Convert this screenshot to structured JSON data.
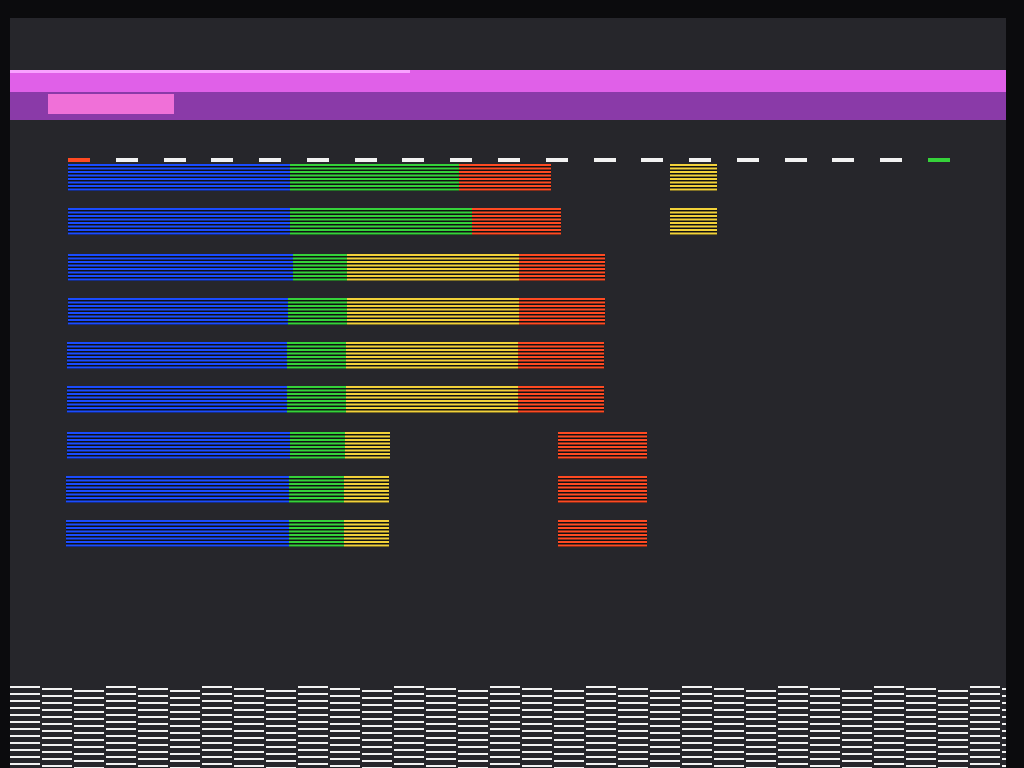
{
  "screen": {
    "description_colors": {
      "background": "#26262b",
      "magenta_light": "#e060e8",
      "magenta_dark": "#8a3aa8",
      "magenta_pink": "#f070d8",
      "blue": "#1a4cff",
      "green": "#35d23a",
      "yellow": "#f2d23a",
      "red": "#ff4a22",
      "white": "#f2f2f2"
    }
  },
  "bar_rows": [
    {
      "segments": [
        {
          "color": "blue",
          "fraction": 0.46
        },
        {
          "color": "green",
          "fraction": 0.35
        },
        {
          "color": "red",
          "fraction": 0.19
        }
      ]
    },
    {
      "segments": [
        {
          "color": "blue",
          "fraction": 0.45
        },
        {
          "color": "green",
          "fraction": 0.37
        },
        {
          "color": "red",
          "fraction": 0.18
        }
      ]
    },
    {
      "segments": [
        {
          "color": "blue",
          "fraction": 0.42
        },
        {
          "color": "green",
          "fraction": 0.1
        },
        {
          "color": "yellow",
          "fraction": 0.32
        },
        {
          "color": "red",
          "fraction": 0.16
        }
      ]
    },
    {
      "segments": [
        {
          "color": "blue",
          "fraction": 0.41
        },
        {
          "color": "green",
          "fraction": 0.11
        },
        {
          "color": "yellow",
          "fraction": 0.32
        },
        {
          "color": "red",
          "fraction": 0.16
        }
      ]
    },
    {
      "segments": [
        {
          "color": "blue",
          "fraction": 0.41
        },
        {
          "color": "green",
          "fraction": 0.11
        },
        {
          "color": "yellow",
          "fraction": 0.32
        },
        {
          "color": "red",
          "fraction": 0.16
        }
      ]
    },
    {
      "segments": [
        {
          "color": "blue",
          "fraction": 0.41
        },
        {
          "color": "green",
          "fraction": 0.11
        },
        {
          "color": "yellow",
          "fraction": 0.32
        },
        {
          "color": "red",
          "fraction": 0.16
        }
      ]
    },
    {
      "segments": [
        {
          "color": "blue",
          "fraction": 0.69
        },
        {
          "color": "green",
          "fraction": 0.17
        },
        {
          "color": "yellow",
          "fraction": 0.14
        }
      ],
      "detached": "red"
    },
    {
      "segments": [
        {
          "color": "blue",
          "fraction": 0.69
        },
        {
          "color": "green",
          "fraction": 0.17
        },
        {
          "color": "yellow",
          "fraction": 0.14
        }
      ],
      "detached": "red"
    },
    {
      "segments": [
        {
          "color": "blue",
          "fraction": 0.69
        },
        {
          "color": "green",
          "fraction": 0.17
        },
        {
          "color": "yellow",
          "fraction": 0.14
        }
      ],
      "detached": "red"
    }
  ],
  "side_blocks": [
    {
      "color": "yellow"
    },
    {
      "color": "yellow"
    }
  ],
  "dash_row": {
    "count": 19,
    "first_color": "red",
    "last_color": "green",
    "dash_color": "white"
  }
}
